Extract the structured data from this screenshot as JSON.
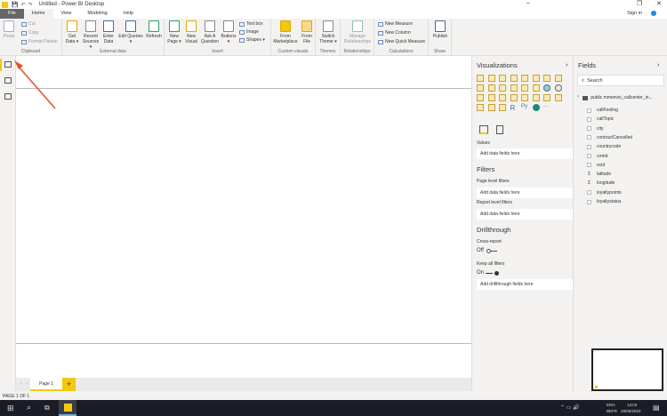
{
  "title": "Untitled - Power BI Desktop",
  "window": {
    "minimize": "–",
    "restore": "❐",
    "close": "✕",
    "sign_in": "Sign in"
  },
  "tabs": [
    "File",
    "Home",
    "View",
    "Modeling",
    "Help"
  ],
  "ribbon": {
    "clipboard": {
      "label": "Clipboard",
      "paste": "Paste",
      "cut": "Cut",
      "copy": "Copy",
      "format_painter": "Format Painter"
    },
    "external": {
      "label": "External data",
      "get_data": "Get Data ▾",
      "recent": "Recent Sources ▾",
      "enter": "Enter Data",
      "edit": "Edit Queries ▾",
      "refresh": "Refresh"
    },
    "insert": {
      "label": "Insert",
      "new_page": "New Page ▾",
      "new_visual": "New Visual",
      "ask": "Ask A Question",
      "buttons": "Buttons ▾",
      "text_box": "Text box",
      "image": "Image",
      "shapes": "Shapes ▾"
    },
    "custom": {
      "label": "Custom visuals",
      "marketplace": "From Marketplace",
      "file": "From File"
    },
    "themes": {
      "label": "Themes",
      "switch": "Switch Theme ▾"
    },
    "relationships": {
      "label": "Relationships",
      "manage": "Manage Relationships"
    },
    "calculations": {
      "label": "Calculations",
      "new_measure": "New Measure",
      "new_column": "New Column",
      "new_quick": "New Quick Measure"
    },
    "share": {
      "label": "Share",
      "publish": "Publish"
    }
  },
  "pages": {
    "tab": "Page 1",
    "add": "+",
    "status": "PAGE 1 OF 1"
  },
  "viz": {
    "title": "Visualizations",
    "chevron": "›",
    "values": "Values",
    "add_fields": "Add data fields here",
    "filters": "Filters",
    "page_filters": "Page level filters",
    "page_add": "Add data fields here",
    "report_filters": "Report level filters",
    "report_add": "Add data fields here",
    "drill": "Drillthrough",
    "cross": "Cross-report",
    "off": "Off",
    "keep": "Keep all filters",
    "on": "On",
    "drill_add": "Add drillthrough fields here",
    "more": "···"
  },
  "fields": {
    "title": "Fields",
    "chevron": "›",
    "search": "Search",
    "table": "public mmeevis_callcenter_in...",
    "items": [
      {
        "n": "callFeeling",
        "s": ""
      },
      {
        "n": "callTopic",
        "s": ""
      },
      {
        "n": "city",
        "s": ""
      },
      {
        "n": "contractCancelled",
        "s": ""
      },
      {
        "n": "countrycode",
        "s": ""
      },
      {
        "n": "crmid",
        "s": ""
      },
      {
        "n": "ecid",
        "s": ""
      },
      {
        "n": "latitude",
        "s": "Σ"
      },
      {
        "n": "longitude",
        "s": "Σ"
      },
      {
        "n": "loyaltypoints",
        "s": ""
      },
      {
        "n": "loyaltystatus",
        "s": ""
      }
    ]
  },
  "taskbar": {
    "lang": "ENG",
    "kb": "BEFR",
    "time": "13:03",
    "date": "28/06/2019"
  },
  "colors": {
    "accent": "#f2c811",
    "arrow": "#e8502a"
  }
}
